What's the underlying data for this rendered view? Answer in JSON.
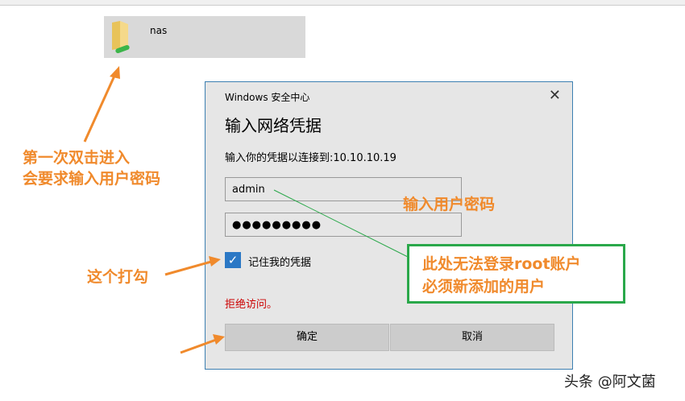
{
  "folder": {
    "name": "nas",
    "icon": "network-folder-icon"
  },
  "dialog": {
    "title": "Windows 安全中心",
    "heading": "输入网络凭据",
    "subtitle": "输入你的凭据以连接到:10.10.10.19",
    "username": "admin",
    "password": "●●●●●●●●●",
    "remember_label": "记住我的凭据",
    "error": "拒绝访问。",
    "ok": "确定",
    "cancel": "取消"
  },
  "annotations": {
    "double_click": [
      "第一次双击进入",
      "会要求输入用户密码"
    ],
    "enter_credentials": "输入用户密码",
    "check": "这个打勾",
    "note": [
      "此处无法登录root账户",
      "必须新添加的用户"
    ]
  },
  "watermark": "头条 @阿文菌"
}
